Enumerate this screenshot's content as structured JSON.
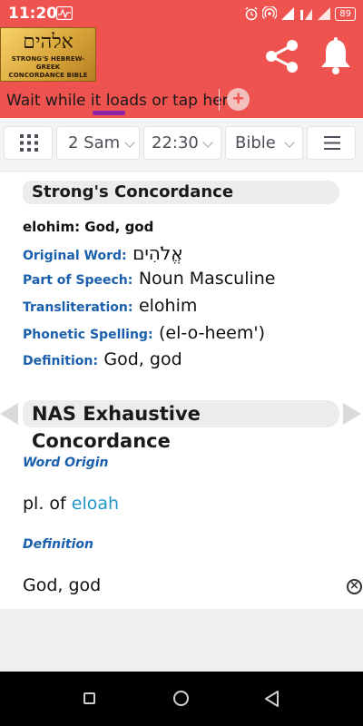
{
  "status_bar": {
    "time": "11:20",
    "battery": "89"
  },
  "header": {
    "logo_hebrew": "אלהים",
    "logo_line1": "STRONG'S HEBREW-GREEK",
    "logo_line2": "CONCORDANCE BIBLE",
    "ad_text": "Wait while it loads or tap here",
    "accent_color": "#ef5350"
  },
  "toolbar": {
    "book": "2 Sam",
    "chapter_verse": "22:30",
    "version": "Bible"
  },
  "strongs": {
    "title": "Strong's Concordance",
    "headword": "elohim: God, god",
    "original_word_label": "Original Word:",
    "original_word_value": "אֱלֹהִים",
    "pos_label": "Part of Speech:",
    "pos_value": "Noun Masculine",
    "translit_label": "Transliteration:",
    "translit_value": "elohim",
    "phonetic_label": "Phonetic Spelling:",
    "phonetic_value": "(el-o-heem')",
    "definition_label": "Definition:",
    "definition_value": "God, god"
  },
  "nas": {
    "title": "NAS Exhaustive Concordance",
    "word_origin_label": "Word Origin",
    "word_origin_prefix": "pl. of",
    "word_origin_link": "eloah",
    "definition_label": "Definition",
    "definition_value": "God, god"
  }
}
